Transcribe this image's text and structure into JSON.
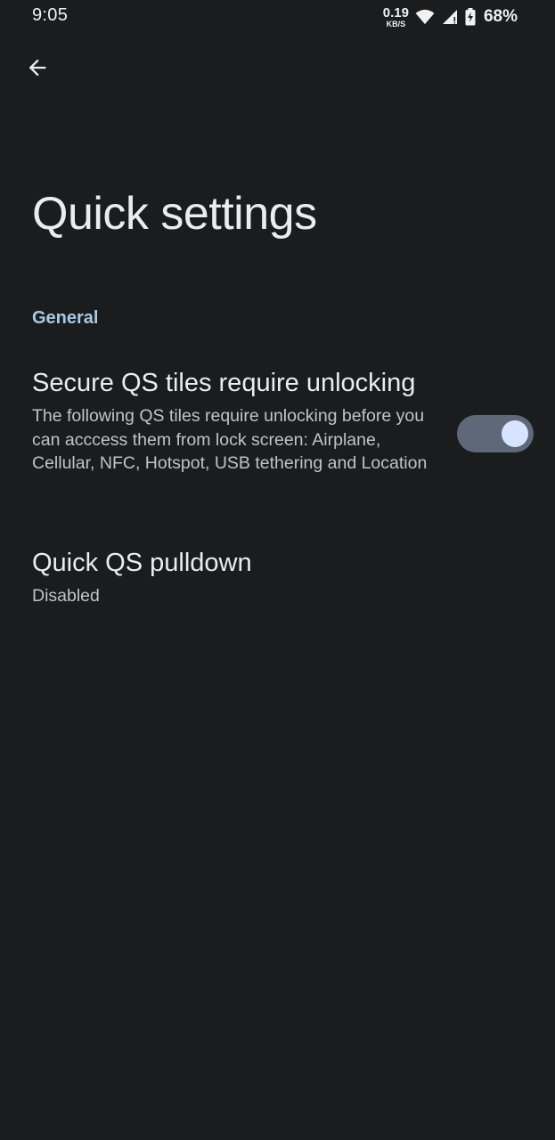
{
  "status_bar": {
    "time": "9:05",
    "net_speed_value": "0.19",
    "net_speed_unit": "KB/S",
    "battery_percent": "68%",
    "icons": [
      "wifi-icon",
      "cellular-signal-icon",
      "battery-charging-icon"
    ]
  },
  "toolbar": {
    "back_icon": "arrow-back-icon"
  },
  "page": {
    "title": "Quick settings"
  },
  "sections": {
    "general": {
      "header": "General",
      "items": [
        {
          "title": "Secure QS tiles require unlocking",
          "summary": "The following QS tiles require unlocking before you can acccess them from lock screen: Airplane, Cellular, NFC, Hotspot, USB tethering and Location",
          "toggle_on": true
        },
        {
          "title": "Quick QS pulldown",
          "summary": "Disabled"
        }
      ]
    }
  },
  "colors": {
    "background": "#1b1c1e",
    "accent": "#a9c9e8",
    "toggle_track": "#5e6878",
    "toggle_thumb": "#d6e4ff"
  }
}
